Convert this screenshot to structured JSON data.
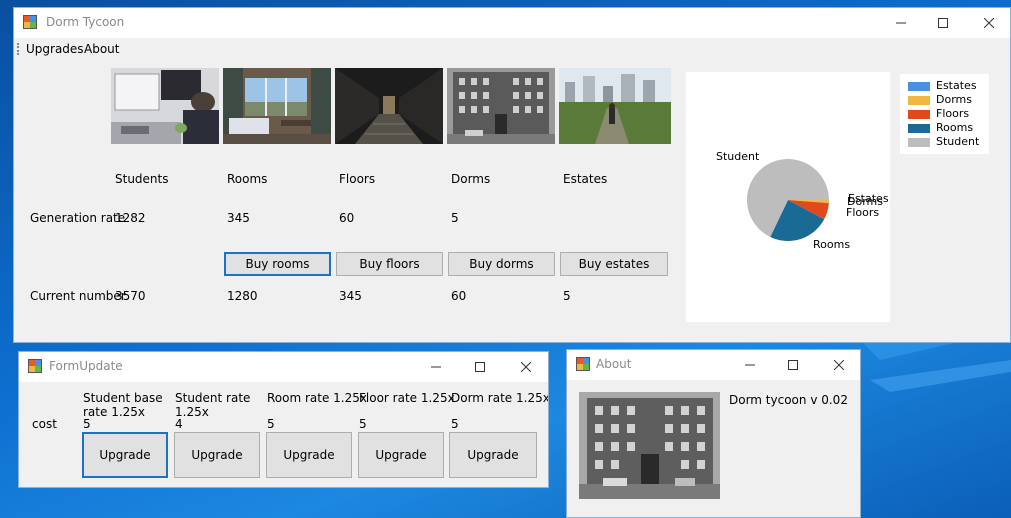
{
  "main": {
    "title": "Dorm Tycoon",
    "menu": [
      "Upgrades",
      "About"
    ],
    "columns": [
      "Students",
      "Rooms",
      "Floors",
      "Dorms",
      "Estates"
    ],
    "generation_rate": {
      "label": "Generation rate",
      "values": [
        "1282",
        "345",
        "60",
        "5"
      ]
    },
    "current_number": {
      "label": "Current number",
      "values": [
        "3570",
        "1280",
        "345",
        "60",
        "5"
      ]
    },
    "buy_buttons": [
      "Buy rooms",
      "Buy floors",
      "Buy dorms",
      "Buy estates"
    ],
    "thumbnails": [
      "student-photo",
      "room-photo",
      "floor-photo",
      "dorm-photo",
      "estate-photo"
    ],
    "pie_labels": {
      "student": "Student",
      "rooms": "Rooms",
      "floors": "Floors",
      "dorms": "Dorms",
      "estates": "Estates"
    }
  },
  "chart_data": {
    "type": "pie",
    "series": [
      {
        "name": "Estates",
        "value": 5,
        "color": "#4a90e2"
      },
      {
        "name": "Dorms",
        "value": 60,
        "color": "#f0b840"
      },
      {
        "name": "Floors",
        "value": 345,
        "color": "#e04a1a"
      },
      {
        "name": "Rooms",
        "value": 1280,
        "color": "#1a6a96"
      },
      {
        "name": "Student",
        "value": 3570,
        "color": "#bdbdbd"
      }
    ],
    "legend": [
      "Estates",
      "Dorms",
      "Floors",
      "Rooms",
      "Student"
    ],
    "legend_position": "top-right"
  },
  "form_update": {
    "title": "FormUpdate",
    "cost_label": "cost",
    "items": [
      {
        "label": "Student base rate 1.25x",
        "cost": "5",
        "button": "Upgrade"
      },
      {
        "label": "Student rate 1.25x",
        "cost": "4",
        "button": "Upgrade"
      },
      {
        "label": "Room rate 1.25x",
        "cost": "5",
        "button": "Upgrade"
      },
      {
        "label": "Floor rate 1.25x",
        "cost": "5",
        "button": "Upgrade"
      },
      {
        "label": "Dorm rate 1.25x",
        "cost": "5",
        "button": "Upgrade"
      }
    ]
  },
  "about": {
    "title": "About",
    "version": "Dorm tycoon v 0.02"
  },
  "icons": {
    "app": "app-icon",
    "minimize": "minimize-icon",
    "maximize": "maximize-icon",
    "close": "close-icon"
  }
}
